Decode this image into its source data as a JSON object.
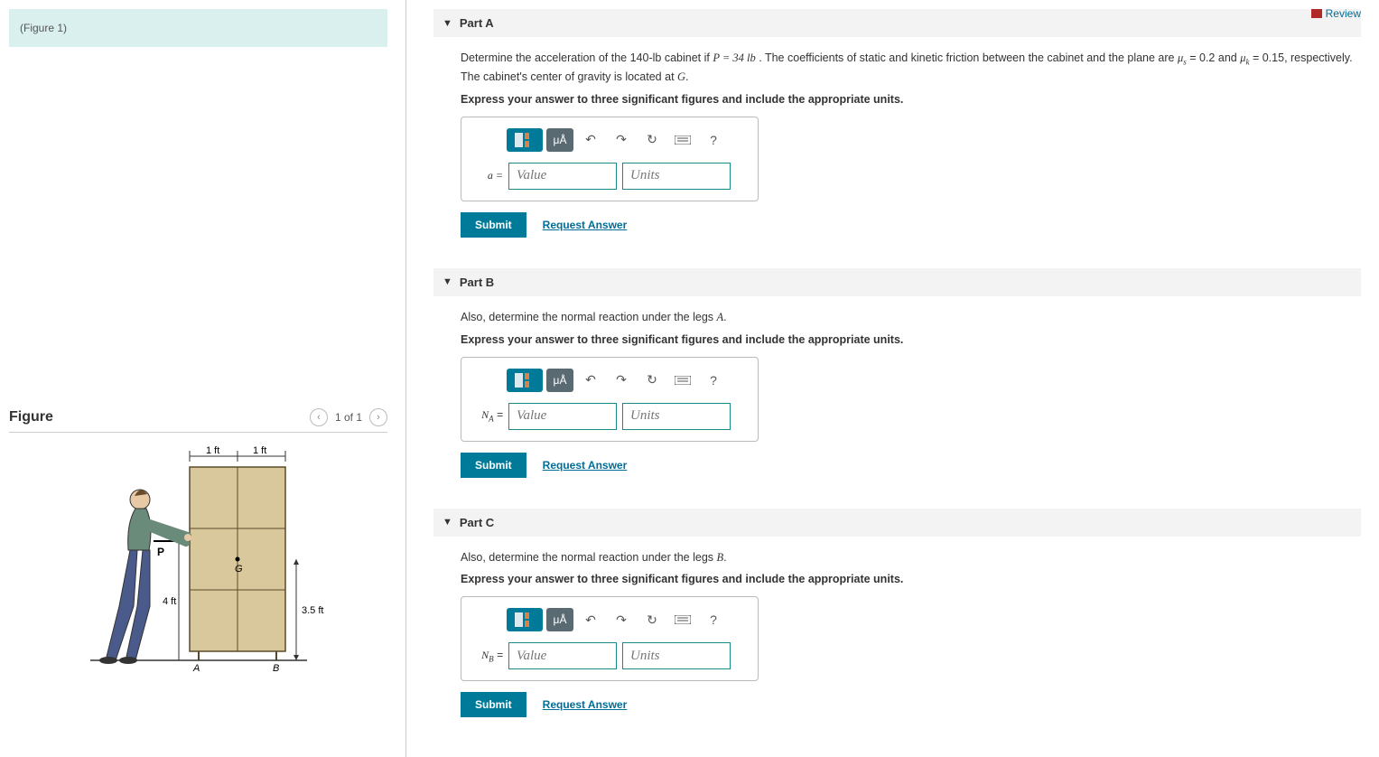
{
  "review": "Review",
  "figure_ref": "(Figure 1)",
  "figure": {
    "title": "Figure",
    "counter": "1 of 1",
    "dims": {
      "top_left": "1 ft",
      "top_right": "1 ft",
      "left_h": "4 ft",
      "right_h": "3.5 ft",
      "leg_a": "A",
      "leg_b": "B",
      "force": "P",
      "cg": "G"
    }
  },
  "parts": {
    "a": {
      "title": "Part A",
      "text_before_P": "Determine the acceleration of the 140-lb cabinet if ",
      "P_eq": "P = 34 lb",
      "text_mid1": " . The coefficients of static and kinetic friction between the cabinet and the plane are ",
      "mu_s": "μ",
      "mu_s_sub": "s",
      "mu_s_val": " = 0.2",
      "and": " and ",
      "mu_k": "μ",
      "mu_k_sub": "k",
      "mu_k_val": " = 0.15",
      "text_after": ", respectively. The cabinet's center of gravity is located at ",
      "G": "G",
      "period": ".",
      "instruction": "Express your answer to three significant figures and include the appropriate units.",
      "label": "a =",
      "value_ph": "Value",
      "units_ph": "Units",
      "submit": "Submit",
      "request": "Request Answer"
    },
    "b": {
      "title": "Part B",
      "text": "Also, determine the normal reaction under the legs ",
      "leg": "A",
      "period": ".",
      "instruction": "Express your answer to three significant figures and include the appropriate units.",
      "label_var": "N",
      "label_sub": "A",
      "label_eq": " =",
      "value_ph": "Value",
      "units_ph": "Units",
      "submit": "Submit",
      "request": "Request Answer"
    },
    "c": {
      "title": "Part C",
      "text": "Also, determine the normal reaction under the legs ",
      "leg": "B",
      "period": ".",
      "instruction": "Express your answer to three significant figures and include the appropriate units.",
      "label_var": "N",
      "label_sub": "B",
      "label_eq": " =",
      "value_ph": "Value",
      "units_ph": "Units",
      "submit": "Submit",
      "request": "Request Answer"
    }
  },
  "toolbar": {
    "units_label": "μÅ",
    "help": "?"
  }
}
